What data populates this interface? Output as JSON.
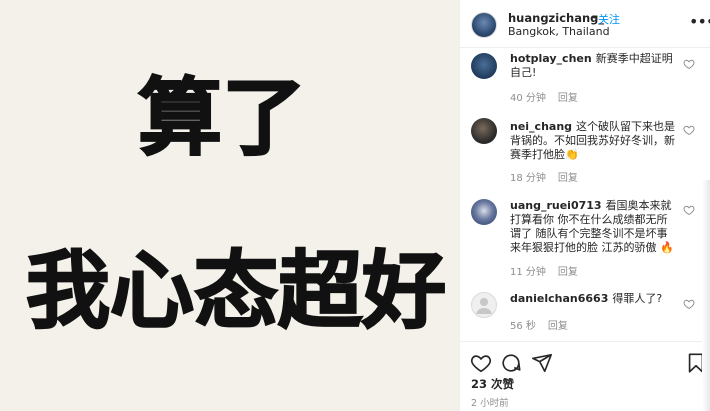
{
  "post_image": {
    "line1": "算了",
    "line2": "我心态超好"
  },
  "header": {
    "username": "huangzichang_",
    "separator": "•",
    "follow_label": "关注",
    "location": "Bangkok, Thailand",
    "more_label": "•••"
  },
  "comments": [
    {
      "user": "hotplay_chen",
      "text": "新赛季中超证明自己!",
      "age": "40 分钟",
      "reply": "回复",
      "avatar_color": "#1f3a5c"
    },
    {
      "user": "nei_chang",
      "text": "这个破队留下来也是背锅的。不如回我苏好好冬训，新赛季打他脸👏",
      "age": "18 分钟",
      "reply": "回复",
      "avatar_color": "#2a2a2a"
    },
    {
      "user": "uang_ruei0713",
      "text": "看国奥本来就打算看你 你不在什么成绩都无所谓了 随队有个完整冬训不是坏事 来年狠狠打他的脸 江苏的骄傲 🔥",
      "age": "11 分钟",
      "reply": "回复",
      "avatar_color": "#3b4f7a"
    },
    {
      "user": "danielchan6663",
      "text": "得罪人了?",
      "age": "56 秒",
      "reply": "回复",
      "avatar_color": "#dbdbdb"
    }
  ],
  "footer": {
    "likes": "23 次赞",
    "time": "2 小时前"
  },
  "colors": {
    "accent": "#0095f6",
    "muted": "#8e8e8e",
    "text": "#262626",
    "post_bg": "#f3f1ea"
  },
  "icons": [
    "heart-icon",
    "comment-icon",
    "share-icon",
    "bookmark-icon",
    "more-icon",
    "like-comment-icon"
  ]
}
